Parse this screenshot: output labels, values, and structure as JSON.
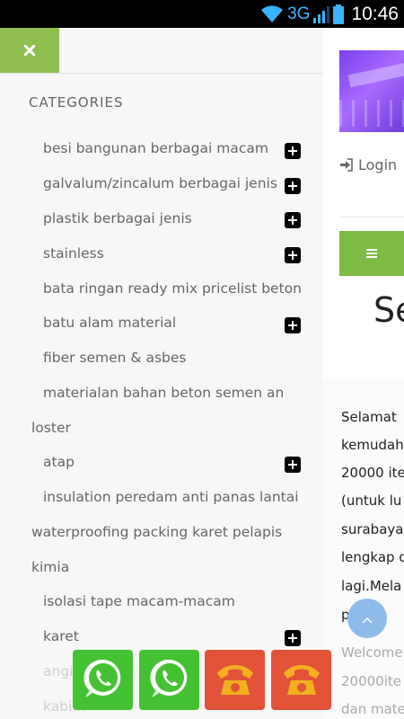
{
  "status_bar": {
    "network": "3G",
    "time": "10:46"
  },
  "page": {
    "login_label": "Login",
    "heading_partial": "Se",
    "paragraph_lines": [
      "Selamat",
      "kemudah",
      "20000 ite",
      "(untuk lu",
      "surabaya",
      "lengkap d",
      "lagi.Mela",
      "p…an/"
    ],
    "faint_lines": [
      "Welcome",
      "20000ite",
      "dan mate"
    ]
  },
  "drawer": {
    "section_title": "CATEGORIES",
    "categories": [
      {
        "label": "besi bangunan berbagai macam",
        "expandable": true
      },
      {
        "label": "galvalum/zincalum berbagai jenis",
        "expandable": true
      },
      {
        "label": "plastik berbagai jenis",
        "expandable": true
      },
      {
        "label": "stainless",
        "expandable": true
      },
      {
        "label": "bata ringan ready mix pricelist beton",
        "expandable": false
      },
      {
        "label": "batu alam material",
        "expandable": true
      },
      {
        "label": "fiber semen & asbes",
        "expandable": false
      },
      {
        "label": "materialan bahan beton semen an",
        "continuation": "loster",
        "expandable": false
      },
      {
        "label": "atap",
        "expandable": true
      },
      {
        "label": "insulation peredam anti panas lantai",
        "continuation": "waterproofing packing karet pelapis",
        "continuation2": "kimia",
        "expandable": false
      },
      {
        "label": "isolasi tape macam-macam",
        "expandable": false
      },
      {
        "label": "karet",
        "expandable": true
      },
      {
        "label": "angi…",
        "expandable": false,
        "faded": true
      },
      {
        "label": "kabi…",
        "expandable": false,
        "faded": true
      }
    ]
  },
  "contact_buttons": [
    {
      "type": "whatsapp",
      "icon": "whatsapp-icon",
      "color": "#45c234"
    },
    {
      "type": "whatsapp",
      "icon": "whatsapp-icon",
      "color": "#45c234"
    },
    {
      "type": "phone",
      "icon": "phone-icon",
      "color": "#e2533a"
    },
    {
      "type": "phone",
      "icon": "phone-icon",
      "color": "#e2533a"
    }
  ],
  "colors": {
    "accent_green": "#8fc04f",
    "menu_green": "#7dbb45",
    "scroll_top_blue": "#8fbce8"
  }
}
